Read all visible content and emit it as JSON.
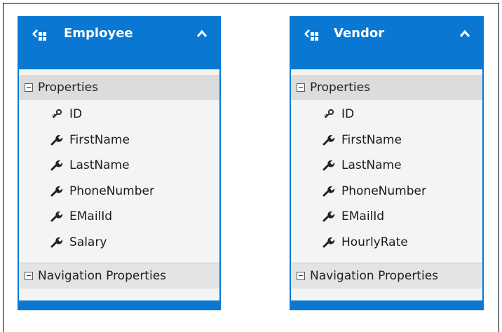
{
  "entities": [
    {
      "title": "Employee",
      "sections": {
        "properties_label": "Properties",
        "navigation_label": "Navigation Properties"
      },
      "properties": [
        {
          "label": "ID",
          "icon": "key-icon"
        },
        {
          "label": "FirstName",
          "icon": "wrench-icon"
        },
        {
          "label": "LastName",
          "icon": "wrench-icon"
        },
        {
          "label": "PhoneNumber",
          "icon": "wrench-icon"
        },
        {
          "label": "EMailId",
          "icon": "wrench-icon"
        },
        {
          "label": "Salary",
          "icon": "wrench-icon"
        }
      ]
    },
    {
      "title": "Vendor",
      "sections": {
        "properties_label": "Properties",
        "navigation_label": "Navigation Properties"
      },
      "properties": [
        {
          "label": "ID",
          "icon": "key-icon"
        },
        {
          "label": "FirstName",
          "icon": "wrench-icon"
        },
        {
          "label": "LastName",
          "icon": "wrench-icon"
        },
        {
          "label": "PhoneNumber",
          "icon": "wrench-icon"
        },
        {
          "label": "EMailId",
          "icon": "wrench-icon"
        },
        {
          "label": "HourlyRate",
          "icon": "wrench-icon"
        }
      ]
    }
  ],
  "colors": {
    "header": "#0a78d2",
    "section_header": "#dcdcdc",
    "body": "#f4f4f4"
  }
}
